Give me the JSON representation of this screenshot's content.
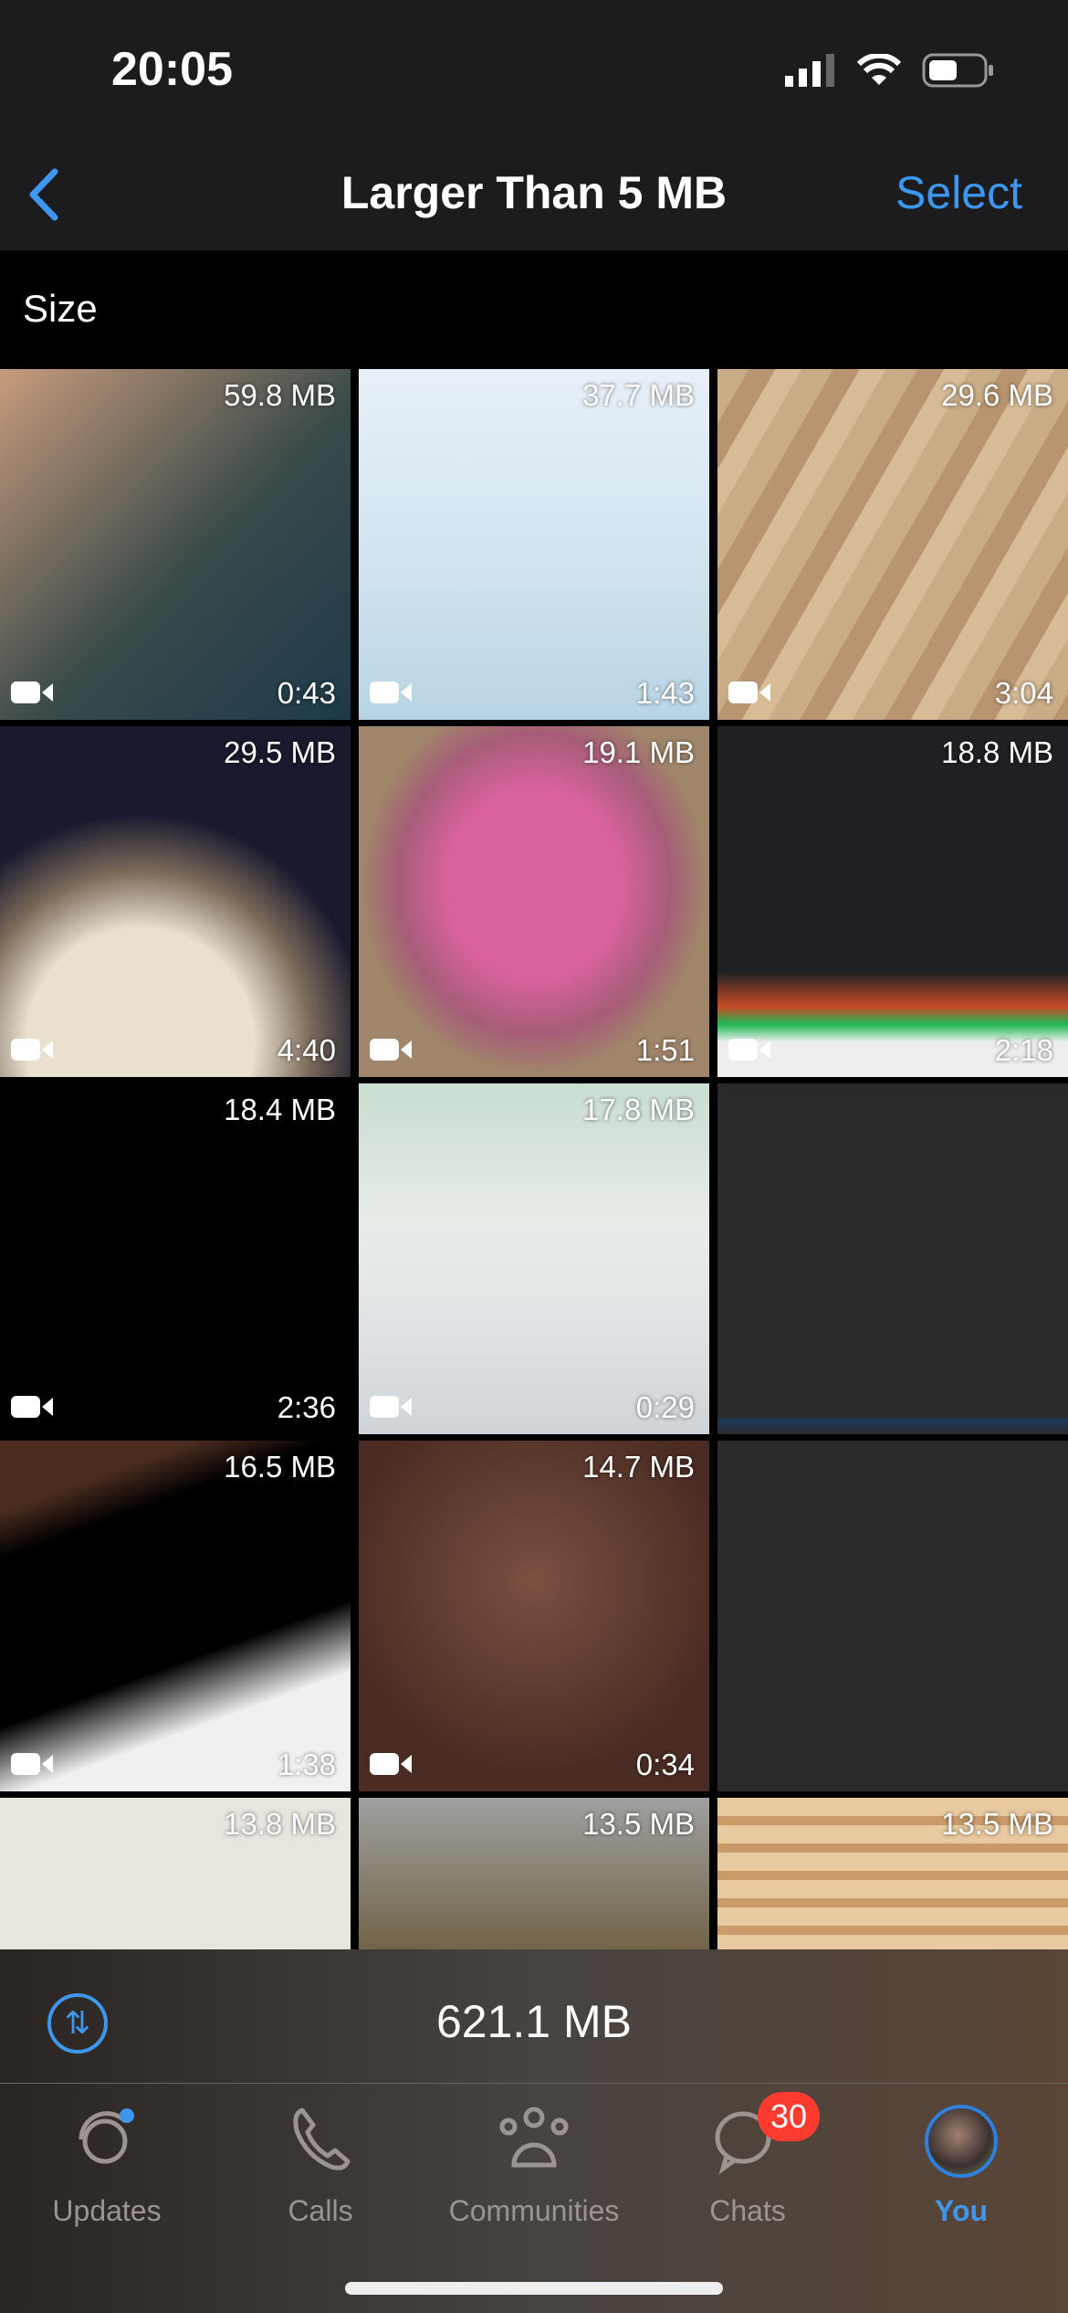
{
  "status": {
    "time": "20:05"
  },
  "nav": {
    "title": "Larger Than 5 MB",
    "select_label": "Select"
  },
  "section": {
    "label": "Size"
  },
  "tiles": [
    {
      "size": "59.8 MB",
      "duration": "0:43",
      "bg": "linear-gradient(135deg,#c79b7c,#3a4a4a 55%,#1d3a4a)"
    },
    {
      "size": "37.7 MB",
      "duration": "1:43",
      "bg": "linear-gradient(180deg,#e8f0f8,#cfe2ee 60%,#b8d4e4)"
    },
    {
      "size": "29.6 MB",
      "duration": "3:04",
      "bg": "repeating-linear-gradient(120deg,#c9ab85 0 30px,#b89570 30px 55px,#d7bb96 55px 80px)"
    },
    {
      "size": "29.5 MB",
      "duration": "4:40",
      "bg": "radial-gradient(circle at 40% 90%,#e9e0d0 30%,#7a6a5a 45%,#1a1a2e 60%)"
    },
    {
      "size": "19.1 MB",
      "duration": "1:51",
      "bg": "radial-gradient(ellipse at 50% 45%,#d9629d 35%,#a65d78 55%,#a0866a 70%)"
    },
    {
      "size": "18.8 MB",
      "duration": "2:18",
      "bg": "linear-gradient(180deg,#202124,#202124 70%,#c94b2a 80%,#1db954 85%,#eee 90%)"
    },
    {
      "size": "18.4 MB",
      "duration": "2:36",
      "bg": "#000"
    },
    {
      "size": "17.8 MB",
      "duration": "0:29",
      "bg": "linear-gradient(180deg,#c9ddd0,#e8ece8 40%,#dfe3e6 70%,#cfd4d8)"
    },
    {
      "size": "",
      "duration": "",
      "bg": "linear-gradient(180deg,#2a2a2c 95%,#1c3a5a 96%,#2a2a2c)"
    },
    {
      "size": "16.5 MB",
      "duration": "1:38",
      "bg": "linear-gradient(160deg,#4a2c20 0 15%,#000 25%,#000 60%,#f0f0f0 75%)"
    },
    {
      "size": "14.7 MB",
      "duration": "0:34",
      "bg": "radial-gradient(circle at 50% 40%,#7a5040,#4a2c24 70%)"
    },
    {
      "size": "",
      "duration": "",
      "bg": "#2a2a2c"
    },
    {
      "size": "13.8 MB",
      "duration": "",
      "bg": "linear-gradient(180deg,#e8e4de 50%,#b05050 75%,#503030)"
    },
    {
      "size": "13.5 MB",
      "duration": "",
      "bg": "linear-gradient(180deg,#a0a0a0,#6a5a3a 50%,#3a3a2a)"
    },
    {
      "size": "13.5 MB",
      "duration": "",
      "bg": "repeating-linear-gradient(180deg,#e8c9a0 0 20px,#c99a6a 20px 30px)"
    }
  ],
  "summary": {
    "total": "621.1 MB"
  },
  "tabs": [
    {
      "label": "Updates",
      "icon": "updates-icon"
    },
    {
      "label": "Calls",
      "icon": "phone-icon"
    },
    {
      "label": "Communities",
      "icon": "communities-icon"
    },
    {
      "label": "Chats",
      "icon": "chats-icon",
      "badge": "30"
    },
    {
      "label": "You",
      "icon": "avatar",
      "active": true
    }
  ],
  "colors": {
    "accent": "#3e97ef",
    "badge": "#ff3b30",
    "bar": "#1c1c1e"
  }
}
